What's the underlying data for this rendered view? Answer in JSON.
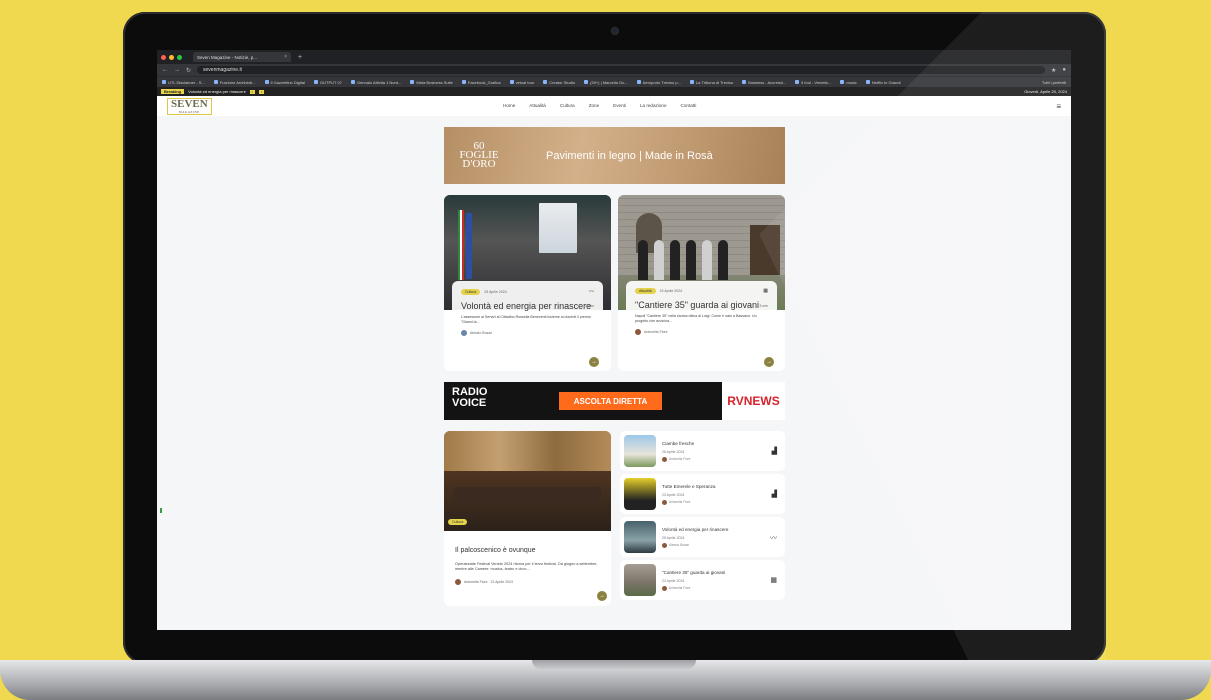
{
  "browser": {
    "tab_title": "Seven Magazine - Notizie, p...",
    "url": "sevenmagazine.it",
    "bookmarks": [
      "UTL Disclaimer - S...",
      "Frazione Archivisti...",
      "Il Gazzettino Digital",
      "OUTPUT 07",
      "Gennaio Attivita 1 Nord...",
      "Meta Business Suite",
      "Facebook_Grafica",
      "virtual tour",
      "Creator Studio",
      "(39+) | Marcella Gu...",
      "Aeroporto Treviso p...",
      "La Tribuna di Treviso",
      "Business - Accretuli...",
      "Il foul - Venetto...",
      "music",
      "Netflix In Grandi"
    ],
    "bookmarks_right": "Tutti i preferiti"
  },
  "breaking": {
    "badge": "Breaking",
    "headline": "Volontà ed energia per rinascere",
    "date": "Giovedì, Aprile 25, 2024"
  },
  "site": {
    "logo": "SEVEN",
    "logo_sub": "MAGAZINE",
    "menu": [
      "Home",
      "Attualità",
      "Cultura",
      "Zone",
      "Eventi",
      "La redazione",
      "Contatti"
    ]
  },
  "ads": {
    "wood_logo_top": "60",
    "wood_logo_mid": "FOGLIE",
    "wood_logo_bot": "D'ORO",
    "wood_text": "Pavimenti in legno | Made in Rosà",
    "radio_line1": "RADIO",
    "radio_line2": "VOICE",
    "radio_button": "ASCOLTA DIRETTA",
    "rv_news": "RVNEWS"
  },
  "featured": [
    {
      "category": "Cultura",
      "date": "25 Aprile 2024",
      "title": "Volontà ed energia per rinascere",
      "readtime": "3 min",
      "excerpt": "L'assessore ai Servizi al Cittadino Rossella Beneventi insieme ai docenti il premio \"Gianni la...",
      "author": "Alessio Bosari"
    },
    {
      "category": "Attualità",
      "date": "24 Aprile 2024",
      "title": "\"Cantiere 35\" guarda ai giovani",
      "readtime": "3 min",
      "excerpt": "Napoli \"Cantiere 35\" nella storica ottica di Luigi. Come è nato a Bassano. Un progetto che avvicina...",
      "author": "Antonella Fiore"
    }
  ],
  "big_story": {
    "category": "Cultura",
    "title": "Il palcoscenico è ovunque",
    "excerpt": "Operaestate Festival Veneto 2024 ritorna per il terzo festival. Da giugno a settembre, mentre alle Camere: musica, teatro e circo...",
    "author": "Antonella Fiore",
    "date": "22 Aprile 2024"
  },
  "list": [
    {
      "title": "Ciambe fresche",
      "date": "26 Aprile 2024",
      "author": "Antonella Fiore"
    },
    {
      "title": "Tutte Emerele e Speranza",
      "date": "23 Aprile 2024",
      "author": "Antonella Fiore"
    },
    {
      "title": "Volontà ed energia per rinascere",
      "date": "25 Aprile 2024",
      "author": "Alessio Bosari"
    },
    {
      "title": "\"Cantiere 35\" guarda ai giovani",
      "date": "24 Aprile 2024",
      "author": "Antonella Fiore"
    }
  ],
  "colors": {
    "accent": "#e4d24a",
    "button": "#8c8240",
    "radio_orange": "#ff6a1b",
    "background": "#f1d94f"
  }
}
